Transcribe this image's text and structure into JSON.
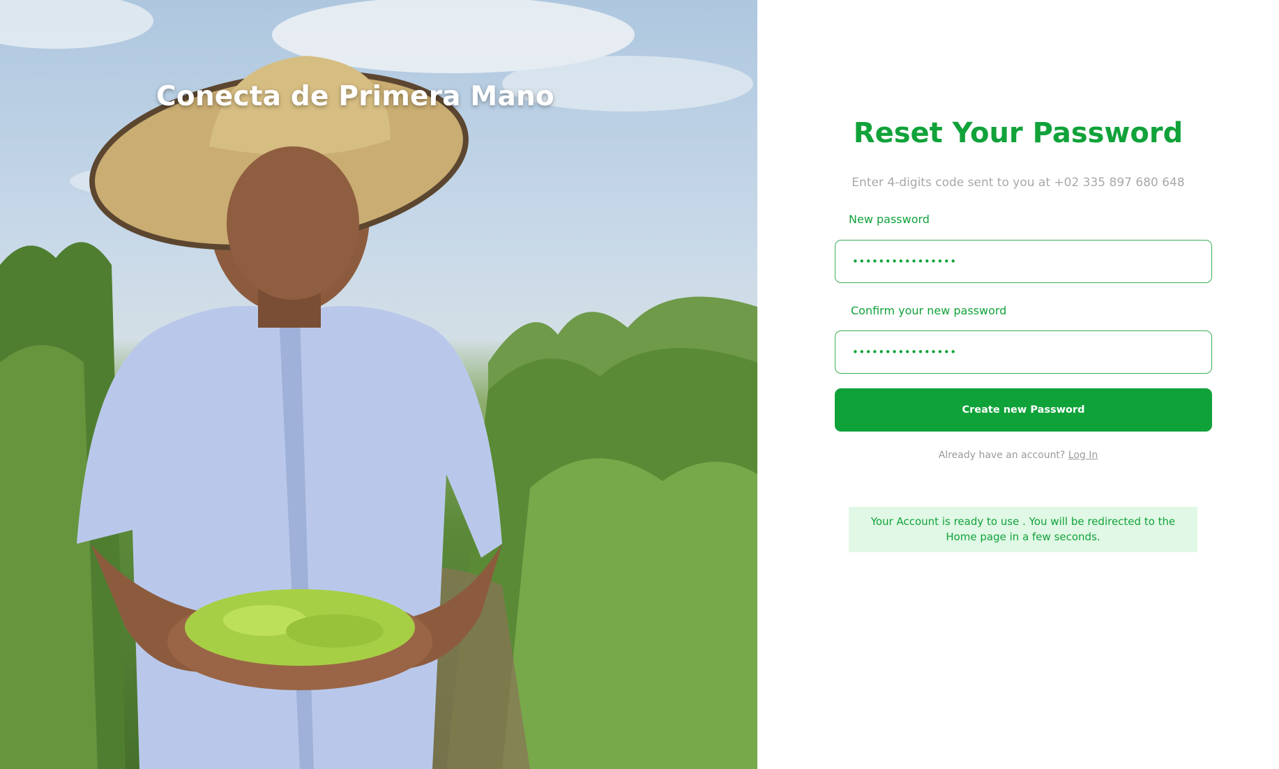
{
  "hero": {
    "title": "Conecta de Primera Mano",
    "image_description_icon": "farmer-photo"
  },
  "form": {
    "title": "Reset Your Password",
    "subtitle": "Enter 4-digits code sent to you at +02 335 897 680 648",
    "new_password": {
      "label": "New password",
      "value": "••••••••••••••••"
    },
    "confirm_password": {
      "label": "Confirm your new password",
      "value": "••••••••••••••••"
    },
    "submit_label": "Create new Password",
    "login_prompt": "Already have an account?",
    "login_link": "Log In",
    "notice": "Your Account is ready to use . You will be redirected to the Home page in a few seconds."
  },
  "colors": {
    "brand_green": "#11a23a",
    "button_green": "#0fa239",
    "notice_bg": "#e1f8e6",
    "muted_text": "#a8a8a8"
  }
}
